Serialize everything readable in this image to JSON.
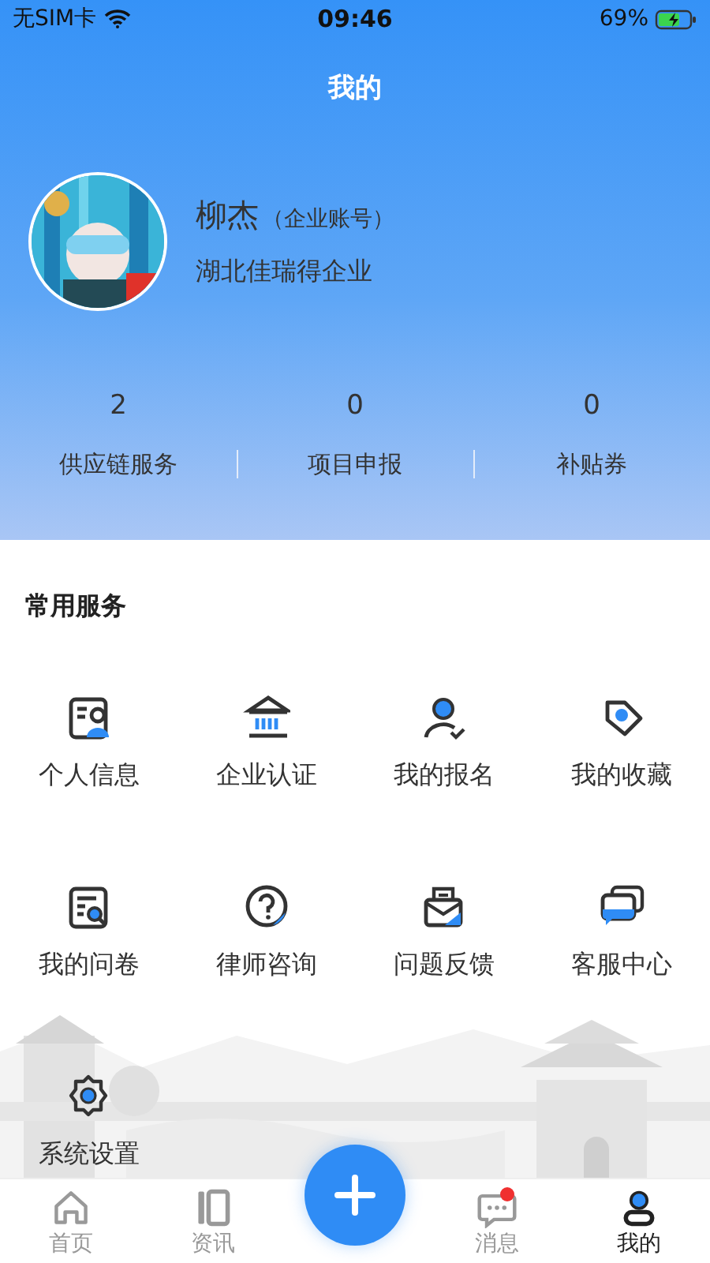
{
  "status_bar": {
    "carrier": "无SIM卡",
    "time": "09:46",
    "battery": "69%"
  },
  "header": {
    "title": "我的"
  },
  "profile": {
    "name": "柳杰",
    "account_type": "（企业账号）",
    "company": "湖北佳瑞得企业"
  },
  "stats": [
    {
      "value": "2",
      "label": "供应链服务"
    },
    {
      "value": "0",
      "label": "项目申报"
    },
    {
      "value": "0",
      "label": "补贴券"
    }
  ],
  "services": {
    "title": "常用服务",
    "items": [
      {
        "label": "个人信息"
      },
      {
        "label": "企业认证"
      },
      {
        "label": "我的报名"
      },
      {
        "label": "我的收藏"
      },
      {
        "label": "我的问卷"
      },
      {
        "label": "律师咨询"
      },
      {
        "label": "问题反馈"
      },
      {
        "label": "客服中心"
      },
      {
        "label": "系统设置"
      }
    ]
  },
  "tab_bar": [
    {
      "kind": "tab",
      "label": "首页",
      "selected": false,
      "badge": false
    },
    {
      "kind": "tab",
      "label": "资讯",
      "selected": false,
      "badge": false
    },
    {
      "kind": "plus"
    },
    {
      "kind": "tab",
      "label": "消息",
      "selected": false,
      "badge": true
    },
    {
      "kind": "tab",
      "label": "我的",
      "selected": true,
      "badge": false
    }
  ]
}
